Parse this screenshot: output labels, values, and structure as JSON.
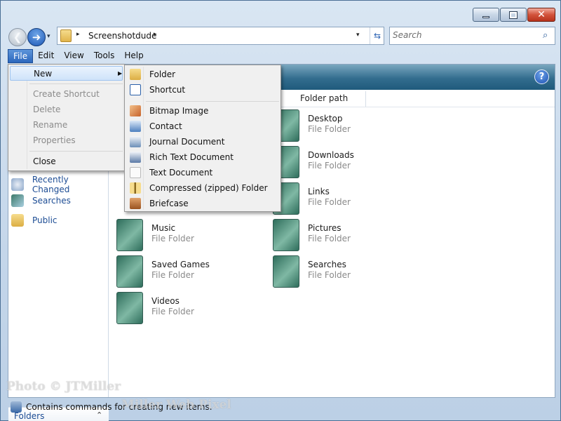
{
  "address": {
    "crumb": "Screenshotdude",
    "separator": "▸",
    "dropdown": "▾",
    "refresh_glyph": "⇆"
  },
  "search": {
    "placeholder": "Search"
  },
  "window_buttons": {
    "close": "✕"
  },
  "nav": {
    "back": "❮",
    "forward": "➜",
    "history": "▾"
  },
  "menu_bar": [
    "File",
    "Edit",
    "View",
    "Tools",
    "Help"
  ],
  "file_menu": {
    "items": [
      {
        "label": "New",
        "disabled": false,
        "highlight": true,
        "submenu": true
      },
      {
        "label": "Create Shortcut",
        "disabled": true
      },
      {
        "label": "Delete",
        "disabled": true
      },
      {
        "label": "Rename",
        "disabled": true
      },
      {
        "label": "Properties",
        "disabled": true
      },
      {
        "label": "Close",
        "disabled": false
      }
    ],
    "submenu_arrow": "▶"
  },
  "new_submenu": {
    "items": [
      {
        "label": "Folder",
        "icon": "folder-icon",
        "color": "#e8c35a"
      },
      {
        "label": "Shortcut",
        "icon": "shortcut-icon",
        "color": "#2a5fa8"
      },
      {
        "label": "Bitmap Image",
        "icon": "bitmap-image-icon",
        "color": "#d9864a"
      },
      {
        "label": "Contact",
        "icon": "contact-icon",
        "color": "#4d7fbf"
      },
      {
        "label": "Journal Document",
        "icon": "journal-document-icon",
        "color": "#6c8fb8"
      },
      {
        "label": "Rich Text Document",
        "icon": "rich-text-document-icon",
        "color": "#5a79a6"
      },
      {
        "label": "Text Document",
        "icon": "text-document-icon",
        "color": "#e9e9e9"
      },
      {
        "label": "Compressed (zipped) Folder",
        "icon": "zipped-folder-icon",
        "color": "#d7b14e"
      },
      {
        "label": "Briefcase",
        "icon": "briefcase-icon",
        "color": "#b86b2a"
      }
    ]
  },
  "help_glyph": "?",
  "column_header": "Folder path",
  "nav_pane": {
    "links": [
      {
        "label": "Recently Changed",
        "icon": "recently-changed-icon"
      },
      {
        "label": "Searches",
        "icon": "searches-icon"
      },
      {
        "label": "Public",
        "icon": "public-folder-icon"
      }
    ],
    "folders_label": "Folders",
    "folders_chevron": "⌃"
  },
  "files": [
    {
      "name": "Desktop",
      "type": "File Folder"
    },
    {
      "name": "Downloads",
      "type": "File Folder"
    },
    {
      "name": "Links",
      "type": "File Folder"
    },
    {
      "name": "Music",
      "type": "File Folder"
    },
    {
      "name": "Pictures",
      "type": "File Folder"
    },
    {
      "name": "Saved Games",
      "type": "File Folder"
    },
    {
      "name": "Searches",
      "type": "File Folder"
    },
    {
      "name": "Videos",
      "type": "File Folder"
    }
  ],
  "status": {
    "text": "Contains commands for creating new items."
  },
  "watermark": {
    "line1": "Photo © JTMiller",
    "line2": "Miller Web Pixel"
  }
}
